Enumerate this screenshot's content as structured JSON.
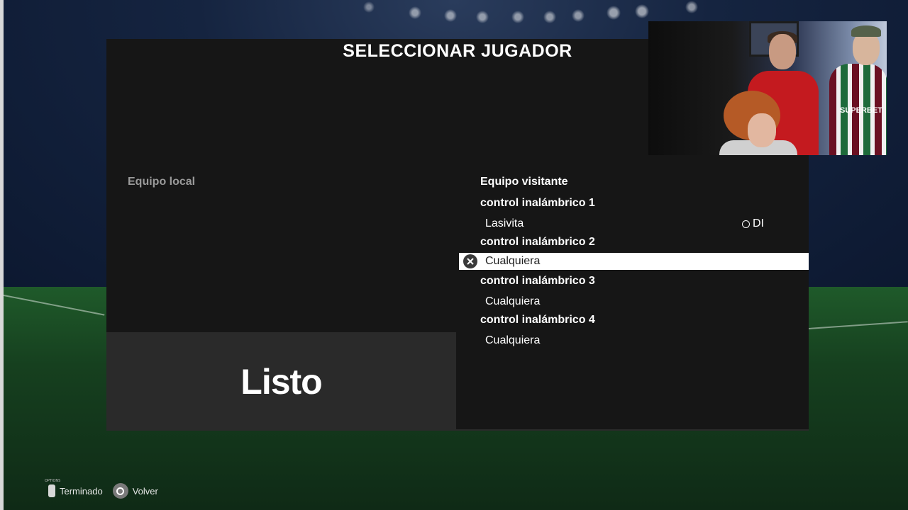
{
  "screen": {
    "title": "SELECCIONAR JUGADOR"
  },
  "home_team": {
    "label": "Equipo local",
    "ready_label": "Listo"
  },
  "away_team": {
    "label": "Equipo visitante",
    "controllers": [
      {
        "name": "control inalámbrico 1",
        "player": "Lasivita",
        "tag": "DI",
        "selected": false
      },
      {
        "name": "control inalámbrico 2",
        "player": "Cualquiera",
        "selected": true
      },
      {
        "name": "control inalámbrico 3",
        "player": "Cualquiera",
        "selected": false
      },
      {
        "name": "control inalámbrico 4",
        "player": "Cualquiera",
        "selected": false
      }
    ]
  },
  "footer": {
    "done_label": "Terminado",
    "back_label": "Volver"
  },
  "webcam": {
    "jersey_text": "SUPERBET"
  },
  "colors": {
    "panel": "#161616",
    "ready_box": "#2a2a2a",
    "selection": "#ffffff"
  }
}
